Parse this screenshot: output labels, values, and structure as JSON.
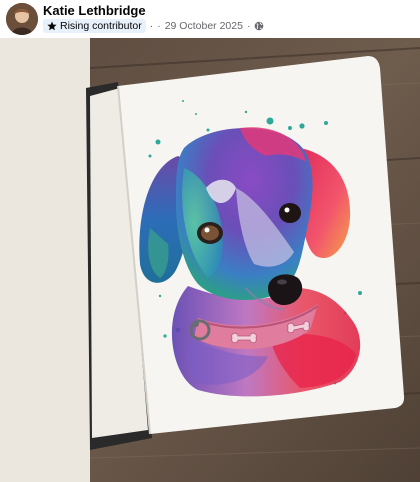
{
  "post": {
    "author_name": "Katie Lethbridge",
    "badge_label": "Rising contributor",
    "date": "29 October 2025",
    "audience_icon": "globe-icon",
    "badge_icon": "star-icon"
  },
  "colors": {
    "badge_bg": "#e7f0fb",
    "meta_text": "#65676b",
    "name_text": "#050505"
  }
}
